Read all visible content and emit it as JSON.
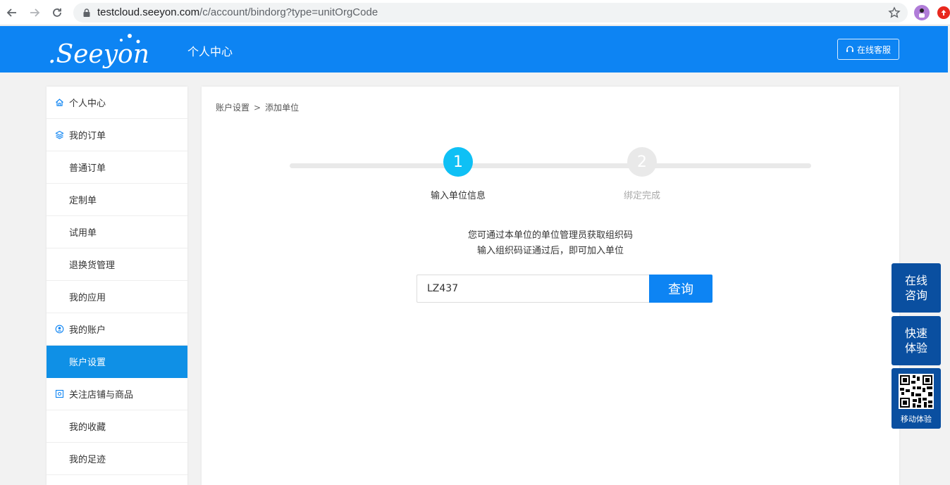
{
  "browser": {
    "url_host": "testcloud.seeyon.com",
    "url_path": "/c/account/bindorg?type=unitOrgCode"
  },
  "header": {
    "logo_text": ".Seeyon",
    "title": "个人中心",
    "service_label": "在线客服"
  },
  "sidebar": {
    "items": [
      {
        "label": "个人中心",
        "type": "group",
        "icon": "home-icon"
      },
      {
        "label": "我的订单",
        "type": "group",
        "icon": "layers-icon"
      },
      {
        "label": "普通订单",
        "type": "sub"
      },
      {
        "label": "定制单",
        "type": "sub"
      },
      {
        "label": "试用单",
        "type": "sub"
      },
      {
        "label": "退换货管理",
        "type": "sub"
      },
      {
        "label": "我的应用",
        "type": "sub"
      },
      {
        "label": "我的账户",
        "type": "group",
        "icon": "user-circle-icon"
      },
      {
        "label": "账户设置",
        "type": "sub",
        "active": true
      },
      {
        "label": "关注店铺与商品",
        "type": "group",
        "icon": "shop-icon"
      },
      {
        "label": "我的收藏",
        "type": "sub"
      },
      {
        "label": "我的足迹",
        "type": "sub"
      }
    ]
  },
  "main": {
    "breadcrumb": {
      "parent": "账户设置",
      "separator": ">",
      "current": "添加单位"
    },
    "steps": [
      {
        "number": "1",
        "label": "输入单位信息",
        "active": true
      },
      {
        "number": "2",
        "label": "绑定完成",
        "active": false
      }
    ],
    "hint_line1": "您可通过本单位的单位管理员获取组织码",
    "hint_line2": "输入组织码证通过后，即可加入单位",
    "org_code_value": "LZ437",
    "query_label": "查询"
  },
  "floating": {
    "consult_line1": "在线",
    "consult_line2": "咨询",
    "quick_line1": "快速",
    "quick_line2": "体验",
    "mobile_label": "移动体验"
  },
  "colors": {
    "brand_blue": "#0d84f3",
    "active_sidebar": "#0f90e6",
    "step_active": "#0fc0f5",
    "float_bg": "#0a4fa0"
  }
}
